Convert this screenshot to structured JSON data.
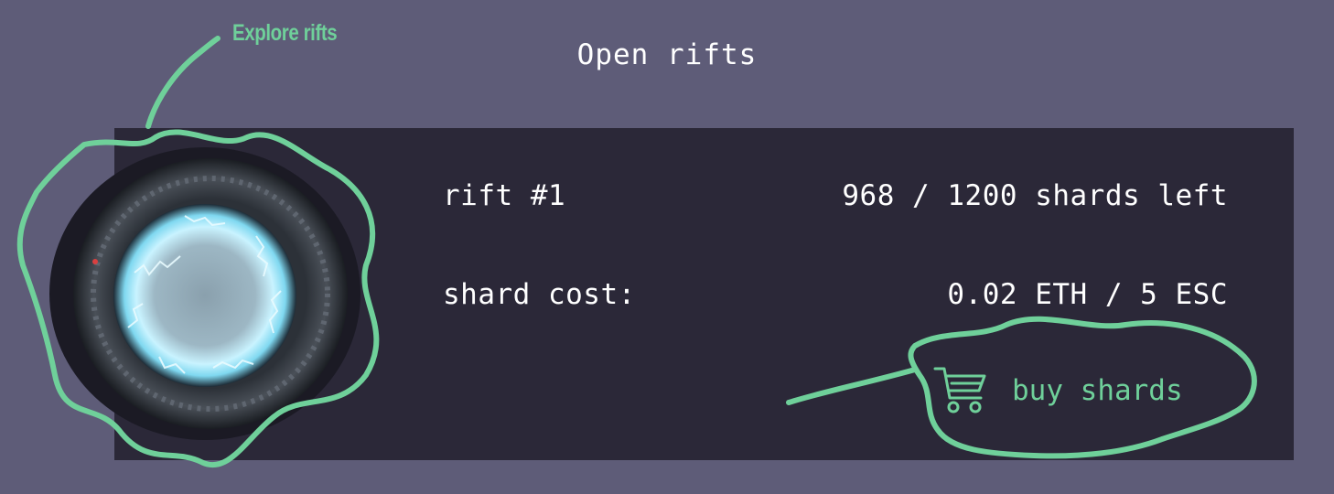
{
  "header": {
    "title": "Open rifts"
  },
  "annotation": {
    "label": "Explore rifts"
  },
  "rift": {
    "name": "rift #1",
    "shards_left": "968 / 1200 shards left",
    "cost_label": "shard cost:",
    "cost_value": "0.02 ETH / 5 ESC",
    "buy_label": "buy shards",
    "buy_icon": "cart-icon",
    "portal_icon": "portal-image"
  },
  "colors": {
    "background": "#5e5c78",
    "card": "#2b2838",
    "text": "#ffffff",
    "accent": "#6fd09a"
  }
}
